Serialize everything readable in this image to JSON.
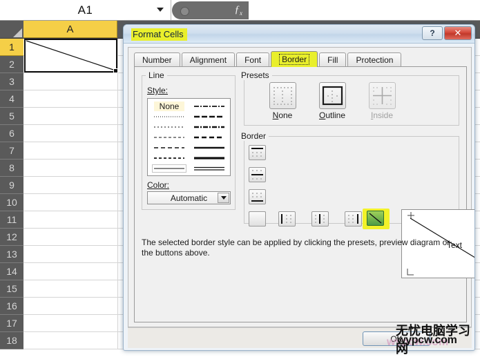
{
  "excel": {
    "name_box_value": "A1",
    "fx_label": "fx",
    "formula_value": "",
    "column_headers": [
      "A"
    ],
    "row_numbers": [
      "1",
      "2",
      "3",
      "4",
      "5",
      "6",
      "7",
      "8",
      "9",
      "10",
      "11",
      "12",
      "13",
      "14",
      "15",
      "16",
      "17",
      "18"
    ],
    "selected_cell": "A1",
    "selected_cell_content": ""
  },
  "dialog": {
    "title": "Format Cells",
    "help_label": "?",
    "close_label": "✕",
    "tabs": [
      {
        "label": "Number",
        "active": false
      },
      {
        "label": "Alignment",
        "active": false
      },
      {
        "label": "Font",
        "active": false
      },
      {
        "label": "Border",
        "active": true
      },
      {
        "label": "Fill",
        "active": false
      },
      {
        "label": "Protection",
        "active": false
      }
    ],
    "line_group": {
      "title": "Line",
      "style_label": "Style:",
      "none_label": "None",
      "color_label": "Color:",
      "color_value": "Automatic"
    },
    "presets_group": {
      "title": "Presets",
      "items": [
        {
          "label": "None",
          "enabled": true
        },
        {
          "label": "Outline",
          "enabled": true
        },
        {
          "label": "Inside",
          "enabled": false
        }
      ]
    },
    "border_group": {
      "title": "Border",
      "preview_text": "Text",
      "left_buttons": [
        "top-border-button",
        "middle-horizontal-border-button",
        "bottom-border-button",
        "diagonal-up-border-button"
      ],
      "bottom_buttons": [
        "diagonal-up-border-button",
        "left-border-button",
        "inside-vertical-border-button",
        "right-border-button",
        "diagonal-down-border-button"
      ],
      "selected_button": "diagonal-down-border-button"
    },
    "hint_text": "The selected border style can be applied by clicking the presets, preview diagram or the buttons above.",
    "ok_label": "OK"
  },
  "watermark": {
    "chinese": "无忧电脑学习网",
    "english": "wypcw.com"
  },
  "colors": {
    "highlight_yellow": "#e9ef2c",
    "selected_green": "#4e9c46",
    "header_gold": "#f5cf47",
    "close_red": "#c0392b"
  }
}
